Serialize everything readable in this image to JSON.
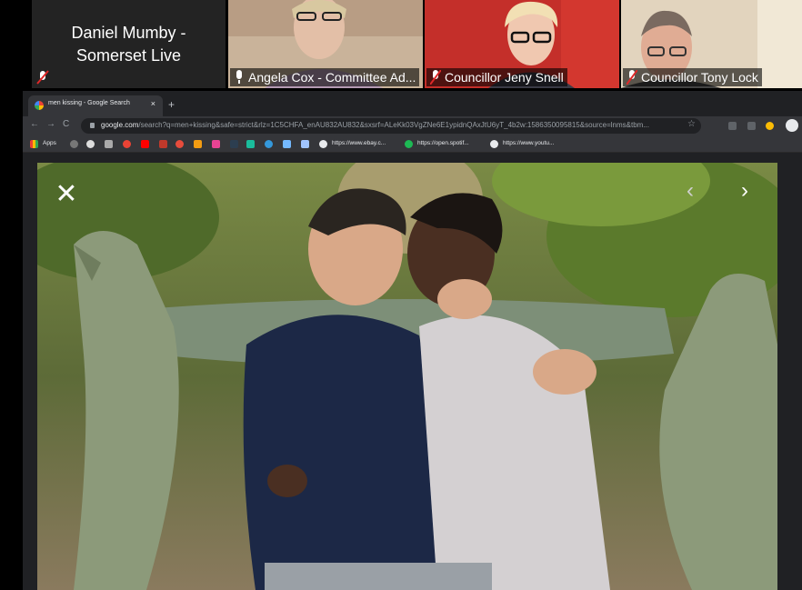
{
  "participants": [
    {
      "name": "Daniel Mumby - Somerset Live",
      "line1": "Daniel Mumby -",
      "line2": "Somerset Live",
      "video": false
    },
    {
      "name": "Angela Cox - Committee Ad...",
      "muted": false
    },
    {
      "name": "Councillor Jeny Snell",
      "muted": true
    },
    {
      "name": "Councillor Tony Lock",
      "muted": true
    }
  ],
  "browser": {
    "tab_title": "men kissing - Google Search",
    "tab_close": "×",
    "new_tab": "+",
    "back": "←",
    "forward": "→",
    "reload": "C",
    "url_host": "google.com",
    "url_rest": "/search?q=men+kissing&safe=strict&rlz=1C5CHFA_enAU832AU832&sxsrf=ALeKk03VgZNe6E1ypidnQAxJtU6yT_4b2w:1586350095815&source=lnms&tbm...",
    "star": "☆",
    "bookmarks": {
      "apps": "Apps",
      "ebay": "https://www.ebay.c...",
      "spotify": "https://open.spotif...",
      "youtube": "https://www.youtu..."
    },
    "accent_color": "#8ab4f8"
  },
  "image_viewer": {
    "close": "✕",
    "prev": "‹",
    "next": "›"
  }
}
